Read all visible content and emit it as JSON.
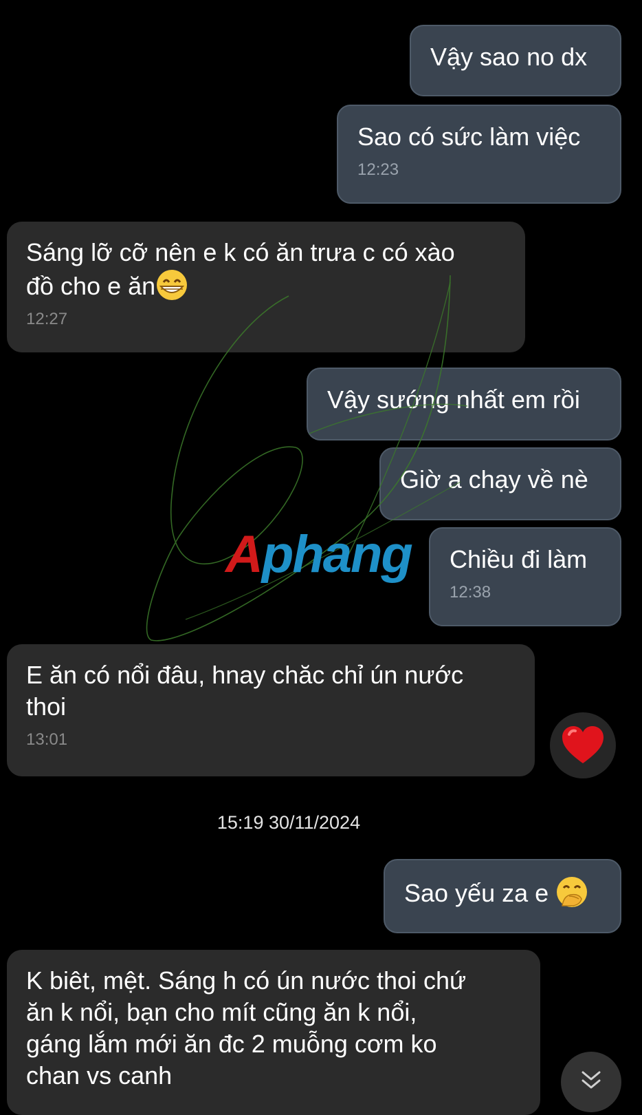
{
  "conversation": {
    "messages": [
      {
        "side": "out",
        "text": "Vậy sao no dx",
        "time": ""
      },
      {
        "side": "out",
        "text": "Sao có sức làm việc",
        "time": "12:23"
      },
      {
        "side": "in",
        "text": "Sáng lỡ cỡ nên e k có ăn trưa c có xào\nđồ cho e ăn",
        "time": "12:27"
      },
      {
        "side": "out",
        "text": "Vậy sướng nhất em rồi",
        "time": ""
      },
      {
        "side": "out",
        "text": "Giờ a chạy về nè",
        "time": ""
      },
      {
        "side": "out",
        "text": "Chiều đi làm",
        "time": "12:38"
      },
      {
        "side": "in",
        "text": "E ăn có nổi đâu, hnay chăc chỉ ún nước\nthoi",
        "time": "13:01"
      },
      {
        "side": "out",
        "text": "Sao yếu za e",
        "time": ""
      },
      {
        "side": "in",
        "text": "K biêt, mệt. Sáng h có ún nước thoi chứ\năn k nổi, bạn cho mít cũng ăn k nổi,\ngáng lắm mới ăn đc 2 muỗng cơm ko\nchan vs canh",
        "time": ""
      }
    ],
    "date_separator": "15:19 30/11/2024",
    "reaction_icon": "red-heart-icon",
    "emojis": [
      "grinning-face-icon",
      "face-with-hand-over-mouth-icon"
    ]
  },
  "watermark": {
    "brand_first": "A",
    "brand_rest": "phang"
  },
  "colors": {
    "background": "#000000",
    "outgoing_bubble": "#3a4450",
    "incoming_bubble": "#2b2b2b",
    "timestamp": "#9aa3ad",
    "brand_red": "#d11a1a",
    "brand_blue": "#1e90c8"
  }
}
